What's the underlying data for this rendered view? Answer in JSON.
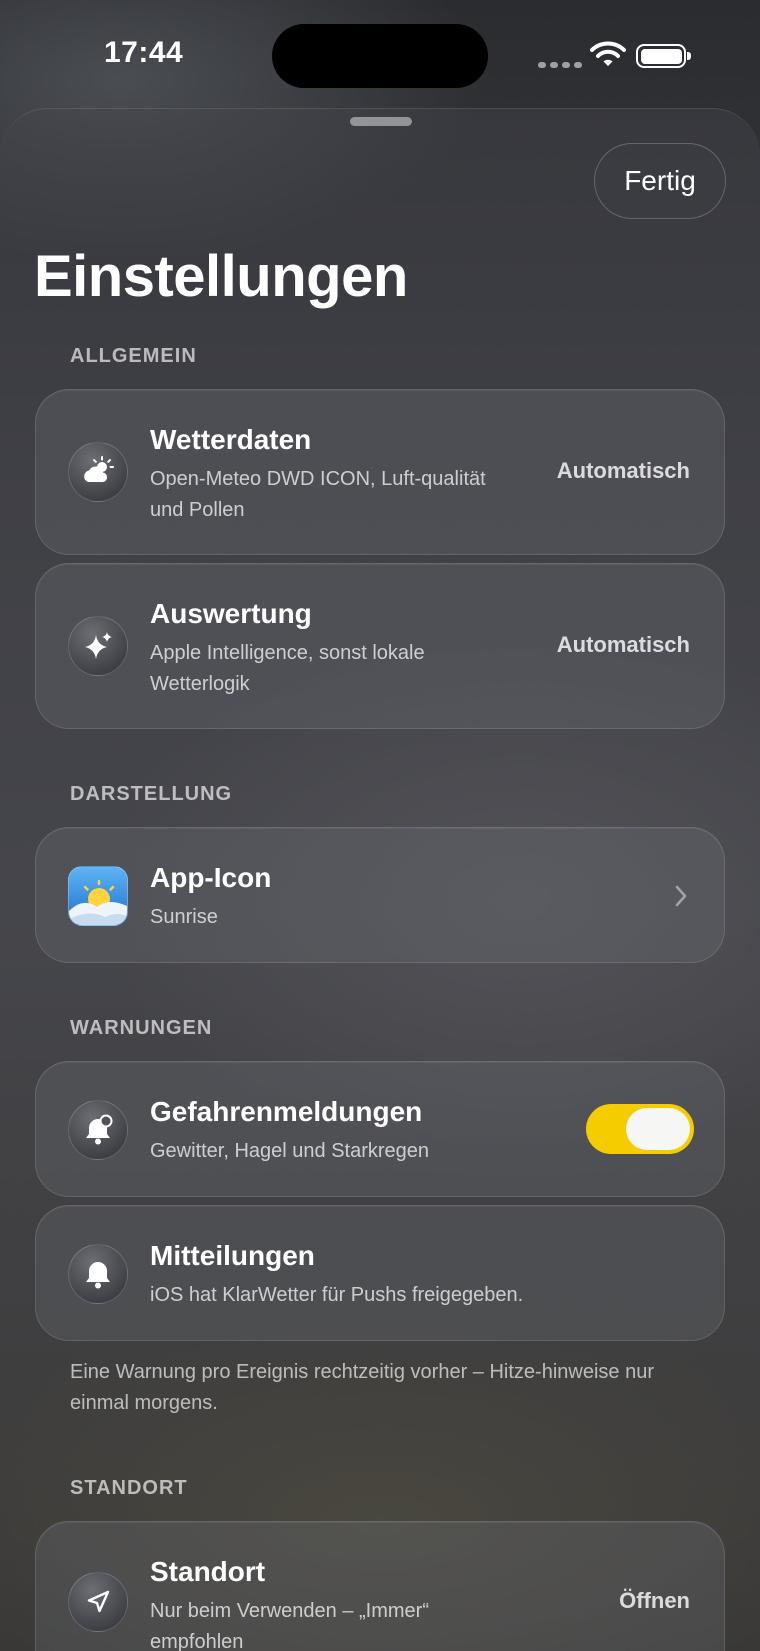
{
  "status_bar": {
    "time": "17:44"
  },
  "header": {
    "done_label": "Fertig",
    "title": "Einstellungen"
  },
  "sections": {
    "allgemein": {
      "label": "ALLGEMEIN",
      "rows": [
        {
          "title": "Wetterdaten",
          "subtitle": "Open-Meteo DWD ICON, Luft-qualität und Pollen",
          "value": "Automatisch",
          "icon": "cloud-sun-icon"
        },
        {
          "title": "Auswertung",
          "subtitle": "Apple Intelligence, sonst lokale Wetterlogik",
          "value": "Automatisch",
          "icon": "sparkles-icon"
        }
      ]
    },
    "darstellung": {
      "label": "DARSTELLUNG",
      "rows": [
        {
          "title": "App-Icon",
          "subtitle": "Sunrise",
          "icon": "app-icon-sunrise"
        }
      ]
    },
    "warnungen": {
      "label": "WARNUNGEN",
      "rows": [
        {
          "title": "Gefahrenmeldungen",
          "subtitle": "Gewitter, Hagel und Starkregen",
          "icon": "bell-badge-icon",
          "toggle_on": true
        },
        {
          "title": "Mitteilungen",
          "subtitle": "iOS hat KlarWetter für Pushs freigegeben.",
          "icon": "bell-icon"
        }
      ],
      "footnote": "Eine Warnung pro Ereignis rechtzeitig vorher – Hitze-hinweise nur einmal morgens."
    },
    "standort": {
      "label": "STANDORT",
      "rows": [
        {
          "title": "Standort",
          "subtitle": "Nur beim Verwenden – „Immer“ empfohlen",
          "value": "Öffnen",
          "icon": "location-arrow-icon"
        }
      ]
    }
  },
  "colors": {
    "toggle_on": "#f5cc00",
    "knob": "#f6f6f4"
  }
}
